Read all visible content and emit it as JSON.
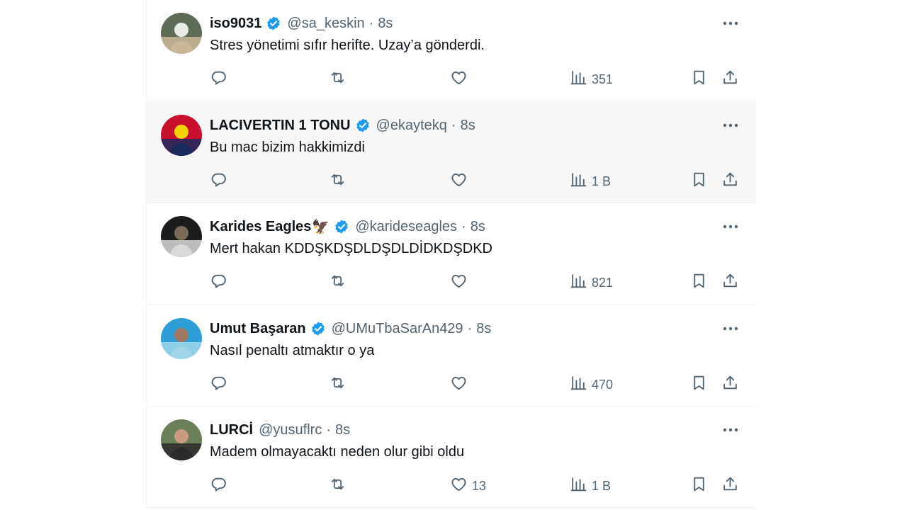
{
  "tweets": [
    {
      "name": "iso9031",
      "name_emoji": "",
      "verified": true,
      "handle": "@sa_keskin",
      "time": "8s",
      "text": "Stres yönetimi sıfır herifte. Uzay’a gönderdi.",
      "reply_count": "",
      "retweet_count": "",
      "like_count": "",
      "views": "351",
      "avatar_colors": [
        "#5d6b57",
        "#c9b79a",
        "#e8ece9"
      ],
      "hover": false
    },
    {
      "name": "LACIVERTIN 1 TONU",
      "name_emoji": "",
      "verified": true,
      "handle": "@ekaytekq",
      "time": "8s",
      "text": "Bu mac bizim hakkimizdi",
      "reply_count": "",
      "retweet_count": "",
      "like_count": "",
      "views": "1 B",
      "avatar_colors": [
        "#c8102e",
        "#1b2a5e",
        "#f4d200"
      ],
      "hover": true
    },
    {
      "name": "Karides Eagles",
      "name_emoji": "🦅",
      "verified": true,
      "handle": "@karideseagles",
      "time": "8s",
      "text": "Mert hakan KDDŞKDŞDLDŞDLDİDKDŞDKD",
      "reply_count": "",
      "retweet_count": "",
      "like_count": "",
      "views": "821",
      "avatar_colors": [
        "#1c1c1c",
        "#d9d9d9",
        "#7a6a5a"
      ],
      "hover": false
    },
    {
      "name": "Umut Başaran",
      "name_emoji": "",
      "verified": true,
      "handle": "@UMuTbaSarAn429",
      "time": "8s",
      "text": "Nasıl penaltı atmaktır o ya",
      "reply_count": "",
      "retweet_count": "",
      "like_count": "",
      "views": "470",
      "avatar_colors": [
        "#2e9fd6",
        "#9fd6ea",
        "#a07860"
      ],
      "hover": false
    },
    {
      "name": "LURCİ",
      "name_emoji": "",
      "verified": false,
      "handle": "@yusuflrc",
      "time": "8s",
      "text": "Madem olmayacaktı neden olur gibi oldu",
      "reply_count": "",
      "retweet_count": "",
      "like_count": "13",
      "views": "1 B",
      "avatar_colors": [
        "#6b7f5a",
        "#2b2b2b",
        "#c99c7e"
      ],
      "hover": false
    }
  ],
  "icons": {
    "verified": "verified-badge-icon",
    "more": "more-dots-icon",
    "reply": "reply-icon",
    "retweet": "retweet-icon",
    "like": "like-icon",
    "views": "views-icon",
    "bookmark": "bookmark-icon",
    "share": "share-icon"
  },
  "colors": {
    "verified": "#1d9bf0",
    "text": "#0f1419",
    "secondary": "#536471",
    "border": "#eff3f4",
    "hover_bg": "#f7f7f7"
  }
}
